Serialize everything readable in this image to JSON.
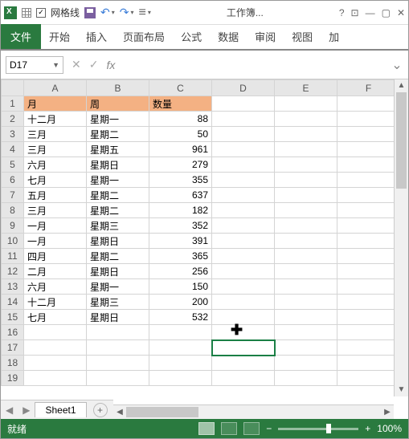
{
  "titlebar": {
    "gridlines_label": "网格线",
    "title": "工作簿...",
    "help": "?"
  },
  "ribbon": {
    "file": "文件",
    "tabs": [
      "开始",
      "插入",
      "页面布局",
      "公式",
      "数据",
      "审阅",
      "视图",
      "加"
    ]
  },
  "fx": {
    "namebox": "D17",
    "fx_label": "fx"
  },
  "columns": [
    "A",
    "B",
    "C",
    "D",
    "E",
    "F"
  ],
  "headers": {
    "A": "月",
    "B": "周",
    "C": "数量"
  },
  "rows": [
    {
      "n": 2,
      "A": "十二月",
      "B": "星期一",
      "C": 88
    },
    {
      "n": 3,
      "A": "三月",
      "B": "星期二",
      "C": 50
    },
    {
      "n": 4,
      "A": "三月",
      "B": "星期五",
      "C": 961
    },
    {
      "n": 5,
      "A": "六月",
      "B": "星期日",
      "C": 279
    },
    {
      "n": 6,
      "A": "七月",
      "B": "星期一",
      "C": 355
    },
    {
      "n": 7,
      "A": "五月",
      "B": "星期二",
      "C": 637
    },
    {
      "n": 8,
      "A": "三月",
      "B": "星期二",
      "C": 182
    },
    {
      "n": 9,
      "A": "一月",
      "B": "星期三",
      "C": 352
    },
    {
      "n": 10,
      "A": "一月",
      "B": "星期日",
      "C": 391
    },
    {
      "n": 11,
      "A": "四月",
      "B": "星期二",
      "C": 365
    },
    {
      "n": 12,
      "A": "二月",
      "B": "星期日",
      "C": 256
    },
    {
      "n": 13,
      "A": "六月",
      "B": "星期一",
      "C": 150
    },
    {
      "n": 14,
      "A": "十二月",
      "B": "星期三",
      "C": 200
    },
    {
      "n": 15,
      "A": "七月",
      "B": "星期日",
      "C": 532
    }
  ],
  "empty_rows": [
    16,
    17,
    18,
    19
  ],
  "selected_cell": "D17",
  "tabs": {
    "sheet": "Sheet1"
  },
  "status": {
    "ready": "就绪",
    "zoom": "100%"
  }
}
